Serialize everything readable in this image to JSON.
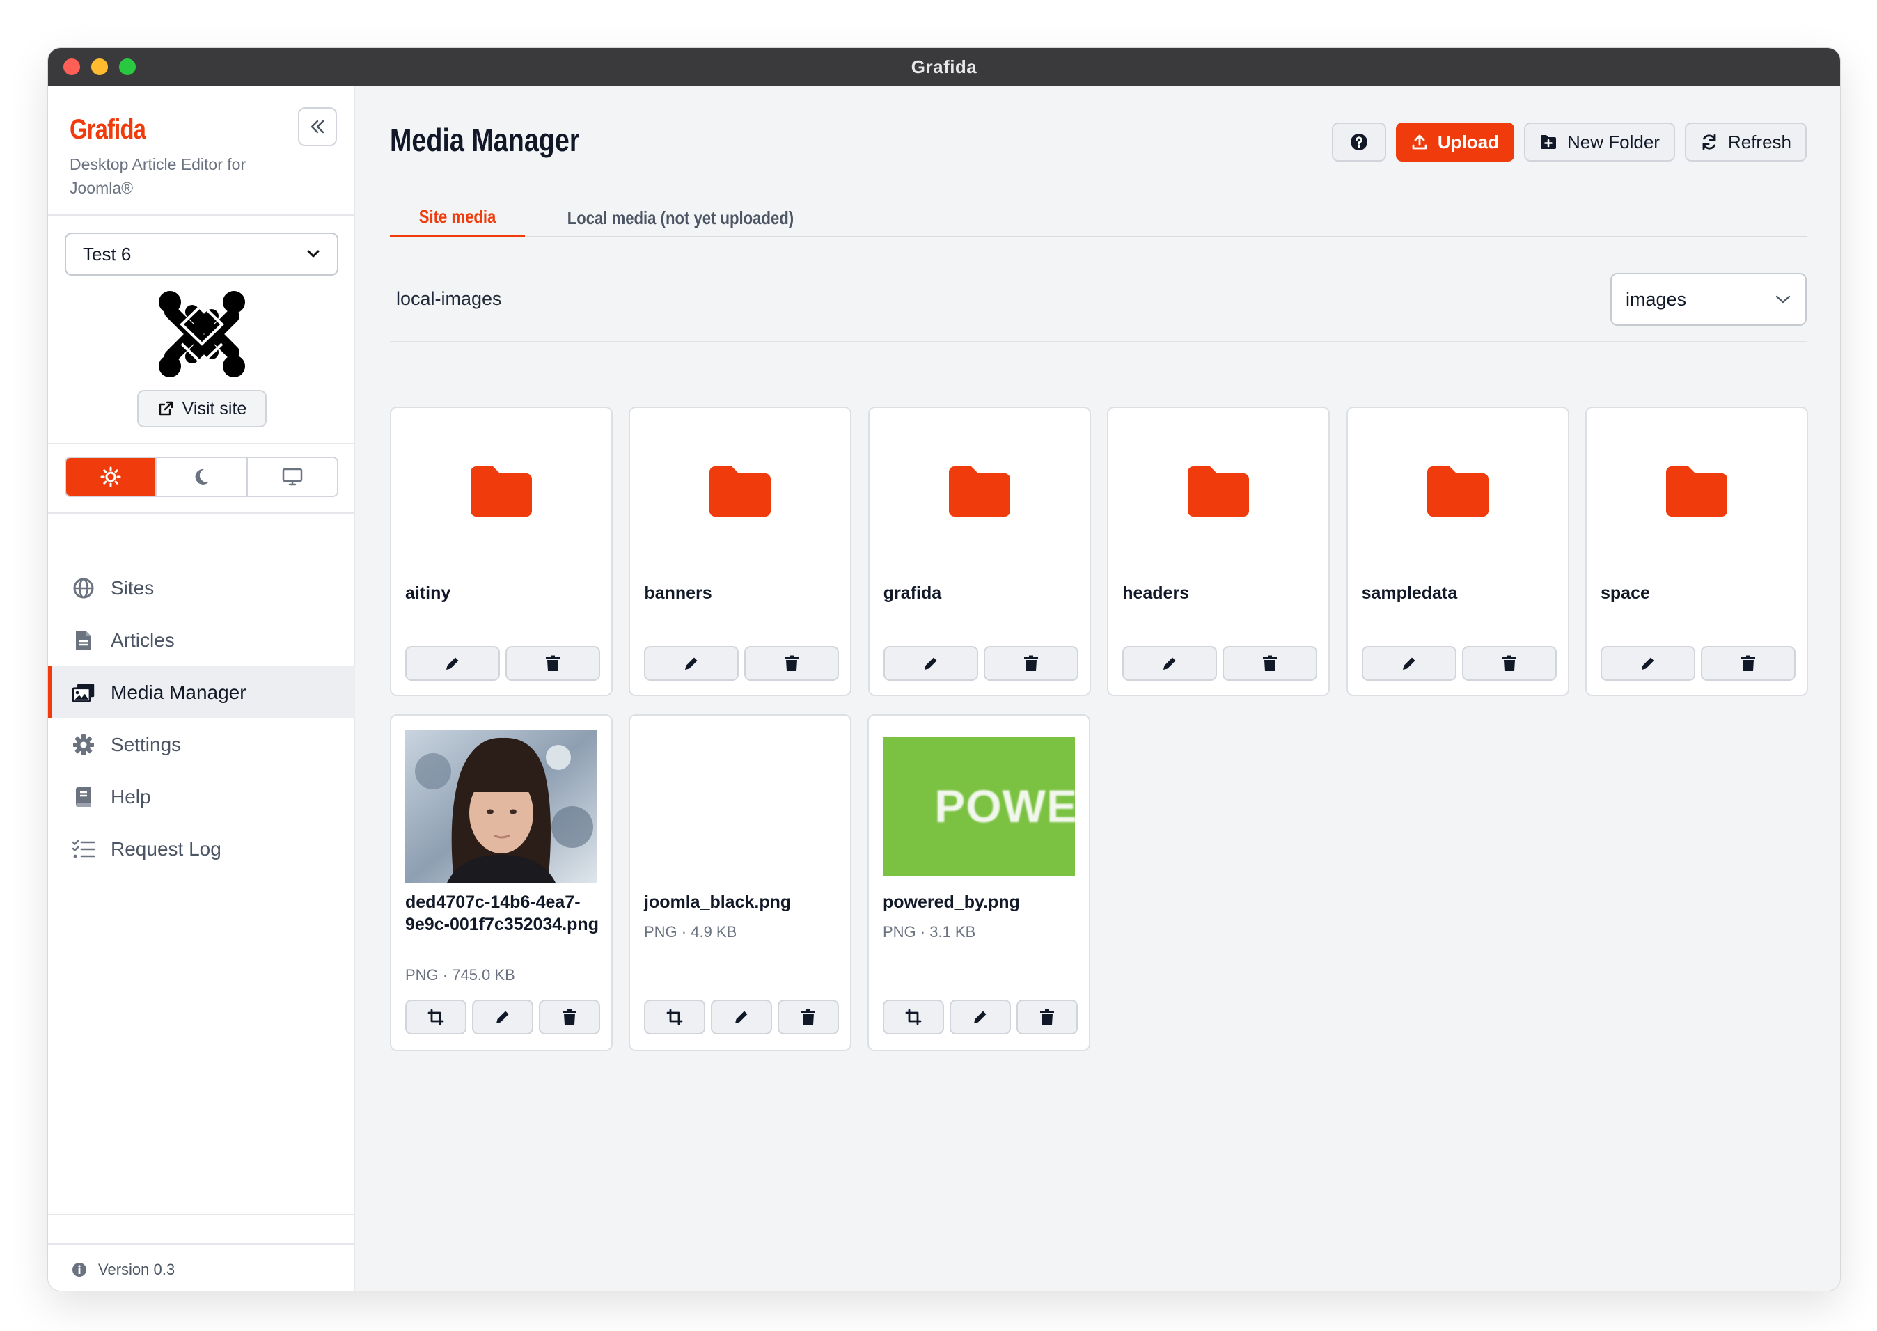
{
  "window": {
    "title": "Grafida"
  },
  "sidebar": {
    "brand": "Grafida",
    "tagline": "Desktop Article Editor for Joomla®",
    "site_select": "Test 6",
    "visit_label": "Visit site",
    "nav": [
      {
        "label": "Sites",
        "icon": "globe-icon"
      },
      {
        "label": "Articles",
        "icon": "document-icon"
      },
      {
        "label": "Media Manager",
        "icon": "images-icon"
      },
      {
        "label": "Settings",
        "icon": "gear-icon"
      },
      {
        "label": "Help",
        "icon": "book-icon"
      },
      {
        "label": "Request Log",
        "icon": "list-check-icon"
      }
    ],
    "active_nav": "Media Manager",
    "version": "Version 0.3"
  },
  "main": {
    "title": "Media Manager",
    "toolbar": {
      "upload": "Upload",
      "new_folder": "New Folder",
      "refresh": "Refresh"
    },
    "tabs": [
      "Site media",
      "Local media (not yet uploaded)"
    ],
    "path": "local-images",
    "folder_select": "images",
    "folders": [
      "aitiny",
      "banners",
      "grafida",
      "headers",
      "sampledata",
      "space"
    ],
    "files": [
      {
        "name": "ded4707c-14b6-4ea7-9e9c-001f7c352034.png",
        "meta": "PNG · 745.0 KB"
      },
      {
        "name": "joomla_black.png",
        "meta": "PNG · 4.9 KB"
      },
      {
        "name": "powered_by.png",
        "meta": "PNG · 3.1 KB",
        "thumb_text": "POWE"
      }
    ]
  },
  "colors": {
    "accent": "#f03c0c",
    "thumb_green": "#7cc242"
  }
}
